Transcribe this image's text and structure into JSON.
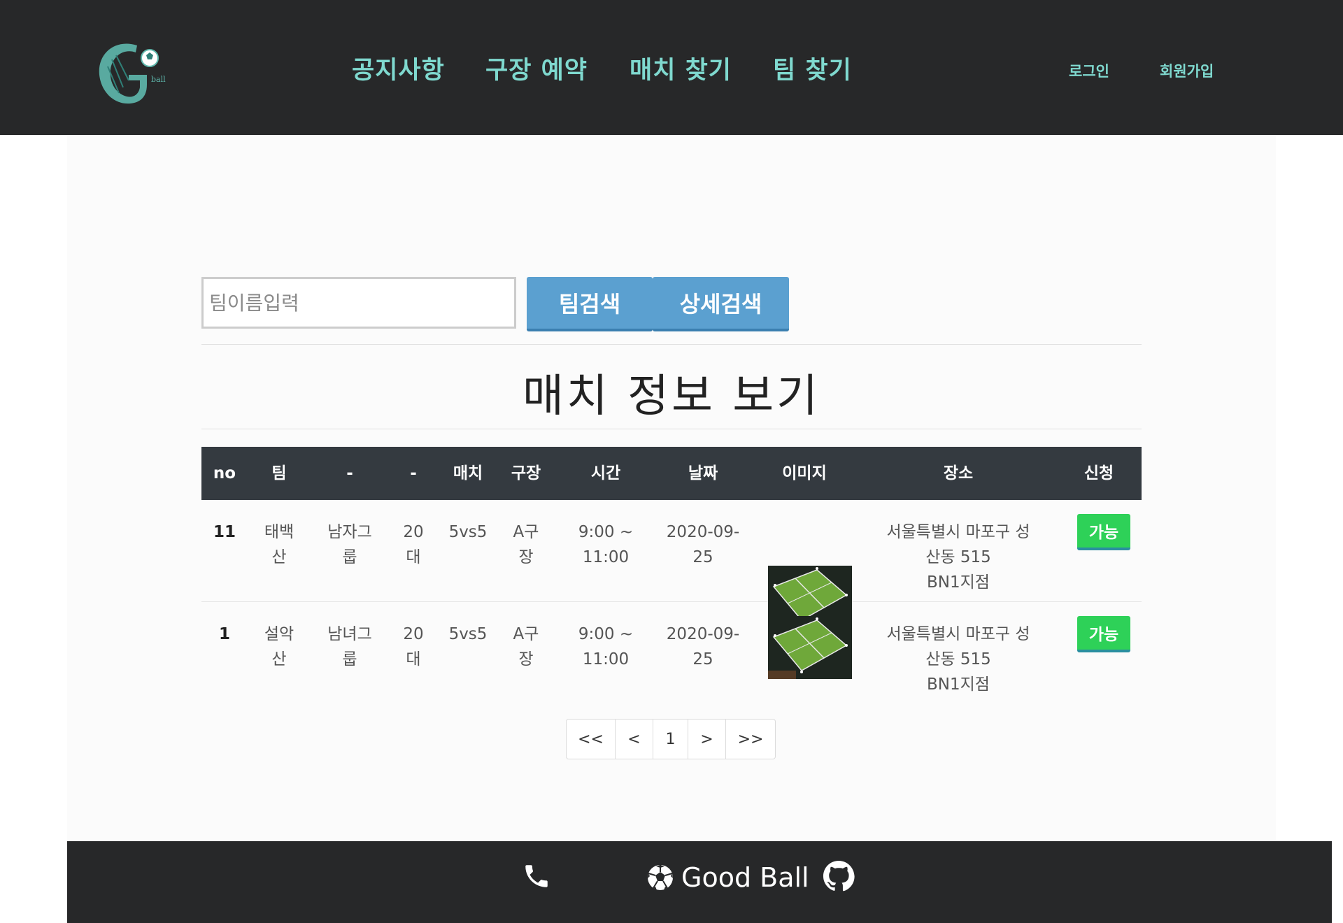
{
  "brand": {
    "logo_alt": "Goodball logo"
  },
  "nav": {
    "items": [
      {
        "label": "공지사항"
      },
      {
        "label": "구장 예약"
      },
      {
        "label": "매치 찾기"
      },
      {
        "label": "팀 찾기"
      }
    ],
    "login": "로그인",
    "signup": "회원가입"
  },
  "search": {
    "placeholder": "팀이름입력",
    "value": "",
    "team_search_label": "팀검색",
    "advanced_search_label": "상세검색"
  },
  "page_title": "매치 정보 보기",
  "table": {
    "headers": [
      "no",
      "팀",
      "-",
      "-",
      "매치",
      "구장",
      "시간",
      "날짜",
      "이미지",
      "장소",
      "신청"
    ],
    "rows": [
      {
        "no": "11",
        "team": [
          "태백",
          "산"
        ],
        "gender": [
          "남자그",
          "룹"
        ],
        "age": [
          "20",
          "대"
        ],
        "match": "5vs5",
        "field": [
          "A구",
          "장"
        ],
        "time": [
          "9:00 ~",
          "11:00"
        ],
        "date": [
          "2020-09-",
          "25"
        ],
        "image": "field-photo",
        "place": [
          "서울특별시 마포구 성",
          "산동 515",
          "BN1지점"
        ],
        "apply": "가능"
      },
      {
        "no": "1",
        "team": [
          "설악",
          "산"
        ],
        "gender": [
          "남녀그",
          "룹"
        ],
        "age": [
          "20",
          "대"
        ],
        "match": "5vs5",
        "field": [
          "A구",
          "장"
        ],
        "time": [
          "9:00 ~",
          "11:00"
        ],
        "date": [
          "2020-09-",
          "25"
        ],
        "image": "field-photo",
        "place": [
          "서울특별시 마포구 성",
          "산동 515",
          "BN1지점"
        ],
        "apply": "가능"
      }
    ]
  },
  "pagination": [
    "<<",
    "<",
    "1",
    ">",
    ">>"
  ],
  "footer": {
    "phone_icon": "phone-icon",
    "ball_icon": "soccer-ball-icon",
    "brand": "Good Ball",
    "github_icon": "github-icon"
  },
  "colors": {
    "header_bg": "#272829",
    "nav_text": "#7fd9cf",
    "button_blue": "#5ba0d0",
    "apply_green": "#2ed158",
    "table_head": "#343a40"
  }
}
